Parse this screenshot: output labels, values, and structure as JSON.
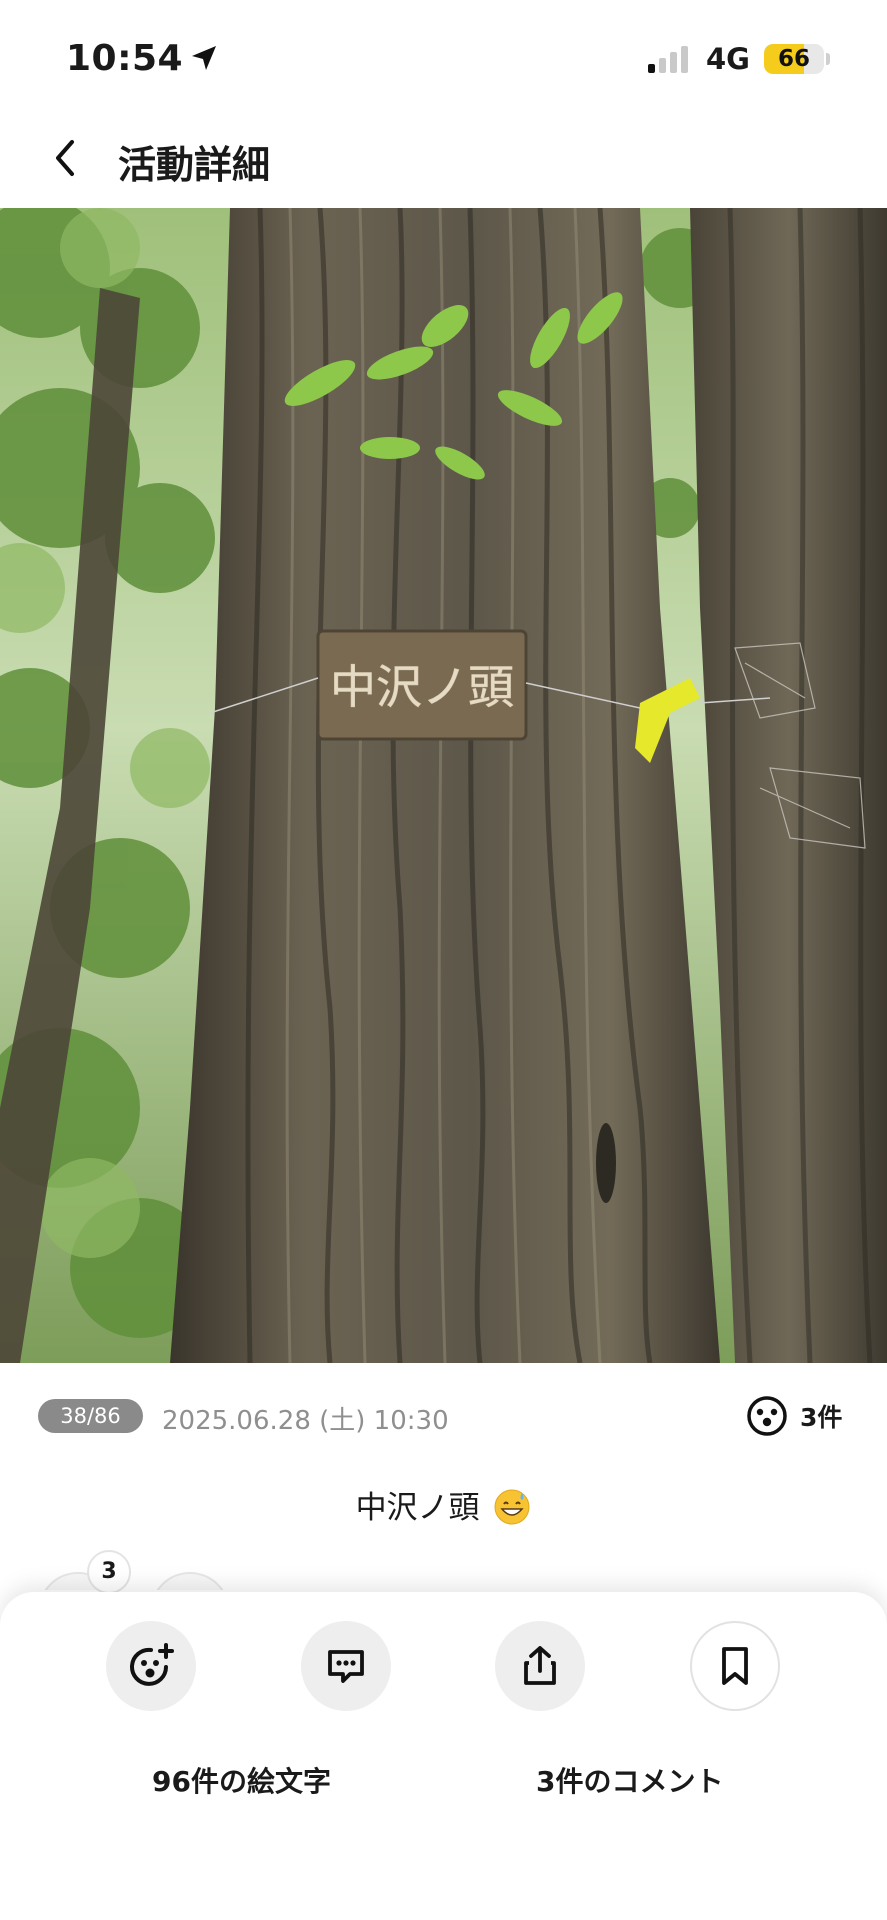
{
  "status_bar": {
    "time": "10:54",
    "network": "4G",
    "battery_level": "66",
    "battery_fraction": 0.66,
    "signal_bars_active": 1,
    "icons": [
      "location-arrow-icon",
      "signal-icon",
      "battery-icon"
    ]
  },
  "nav": {
    "back_icon": "chevron-left-icon",
    "title": "活動詳細"
  },
  "photo": {
    "sign_text": "中沢ノ頭"
  },
  "meta": {
    "counter": "38/86",
    "date": "2025.06.28 (土) 10:30",
    "reaction_count": "3件",
    "reaction_icon": "smiley-face-icon"
  },
  "caption": {
    "text": "中沢ノ頭",
    "emoji": "grinning-sweat-emoji"
  },
  "reactions_preview": {
    "badge": "3"
  },
  "actions": {
    "buttons": [
      {
        "name": "add-emoji-button",
        "icon": "emoji-plus-icon"
      },
      {
        "name": "comment-button",
        "icon": "comment-icon"
      },
      {
        "name": "share-button",
        "icon": "share-icon"
      },
      {
        "name": "bookmark-button",
        "icon": "bookmark-icon"
      }
    ],
    "emoji_label": "96件の絵文字",
    "comment_label": "3件のコメント"
  },
  "colors": {
    "battery": "#f5cc1c",
    "pill": "#8a8a8a",
    "muted_text": "#8f8f8f",
    "sheet_button": "#eeeeee"
  }
}
